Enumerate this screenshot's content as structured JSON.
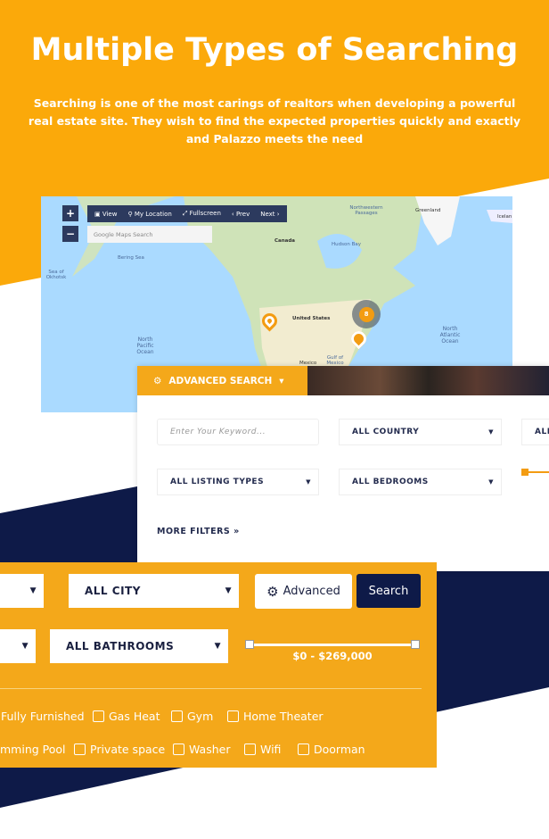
{
  "header": {
    "title": "Multiple Types of Searching",
    "subtitle": "Searching is one of the most carings of realtors when developing a powerful real estate site. They wish to find the expected properties quickly and exactly and Palazzo meets the need"
  },
  "colors": {
    "orange": "#f4a81a",
    "navy": "#0e1a48",
    "header_orange": "#fba90a"
  },
  "map": {
    "zoom_in": "+",
    "zoom_out": "−",
    "toolbar": [
      "View",
      "My Location",
      "Fullscreen",
      "Prev",
      "Next"
    ],
    "search_placeholder": "Google Maps Search",
    "labels": {
      "greenland": "Greenland",
      "iceland": "Icelan",
      "canada": "Canada",
      "us": "United States",
      "mexico": "Mexico",
      "hudson": "Hudson Bay",
      "bering": "Bering Sea",
      "okhotsk": "Sea of Okhotsk",
      "npacific": "North Pacific Ocean",
      "natlantic": "North Atlantic Ocean",
      "gulf": "Gulf of Mexico",
      "nw": "Northwestern Passages"
    },
    "cluster_count": "8"
  },
  "advanced": {
    "title": "ADVANCED SEARCH",
    "keyword_placeholder": "Enter Your Keyword...",
    "country": "ALL COUNTRY",
    "third": "ALL",
    "listing_types": "ALL LISTING TYPES",
    "bedrooms": "ALL BEDROOMS",
    "more_filters": "MORE FILTERS"
  },
  "bottom": {
    "city": "ALL CITY",
    "advanced_btn": "Advanced",
    "search_btn": "Search",
    "bathrooms": "ALL BATHROOMS",
    "price_range": "$0 - $269,000",
    "price_min": 0,
    "price_max": 269000,
    "amenities_row1": [
      "Fully Furnished",
      "Gas Heat",
      "Gym",
      "Home Theater"
    ],
    "amenities_row2": [
      "mming Pool",
      "Private space",
      "Washer",
      "Wifi",
      "Doorman"
    ]
  }
}
